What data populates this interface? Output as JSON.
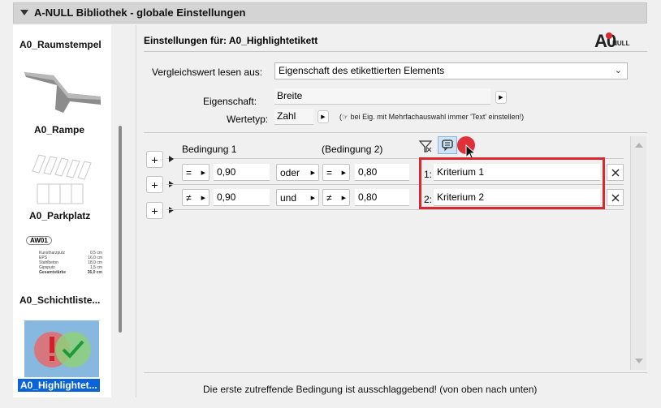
{
  "window": {
    "title": "A-NULL Bibliothek - globale Einstellungen"
  },
  "library": {
    "items": [
      {
        "label": "A0_Raumstempel"
      },
      {
        "label": "A0_Rampe"
      },
      {
        "label": "A0_Parkplatz"
      },
      {
        "label": "A0_Schichtliste..."
      },
      {
        "label": "A0_Highlightet..."
      }
    ],
    "schicht_preview": {
      "tag": "AW01",
      "rows": [
        {
          "name": "Kunstharzputz",
          "value": "0,5 cm"
        },
        {
          "name": "EPS",
          "value": "16,0 cm"
        },
        {
          "name": "Stahlbeton",
          "value": "18,0 cm"
        },
        {
          "name": "Gipsputz",
          "value": "1,5 cm"
        },
        {
          "name": "Gesamtstärke",
          "value": "36,0 cm"
        }
      ]
    }
  },
  "settings": {
    "title": "Einstellungen für: A0_Highlightetikett",
    "logo": {
      "text_a0": "A0",
      "text_null": "NULL"
    },
    "compare_label": "Vergleichswert lesen aus:",
    "compare_value": "Eigenschaft des etikettierten Elements",
    "property_label": "Eigenschaft:",
    "property_value": "Breite",
    "type_label": "Wertetyp:",
    "type_value": "Zahl",
    "type_hint": "(☞ bei Eig. mit Mehrfachauswahl immer 'Text' einstellen!)"
  },
  "conditions": {
    "header1": "Bedingung 1",
    "header2": "(Bedingung 2)",
    "rows": [
      {
        "plus": "+",
        "op1": "=",
        "val1": "0,90",
        "conj": "oder",
        "op2": "=",
        "val2": "0,80",
        "num": "1:",
        "criterion": "Kriterium 1"
      },
      {
        "plus": "+",
        "op1": "≠",
        "val1": "0,90",
        "conj": "und",
        "op2": "≠",
        "val2": "0,80",
        "num": "2:",
        "criterion": "Kriterium 2"
      },
      {
        "plus": "+"
      }
    ]
  },
  "footer": {
    "text": "Die erste zutreffende Bedingung ist ausschlaggebend! (von oben nach unten)"
  },
  "colors": {
    "highlight_red": "#d9282f",
    "record_red": "#e0313a"
  }
}
